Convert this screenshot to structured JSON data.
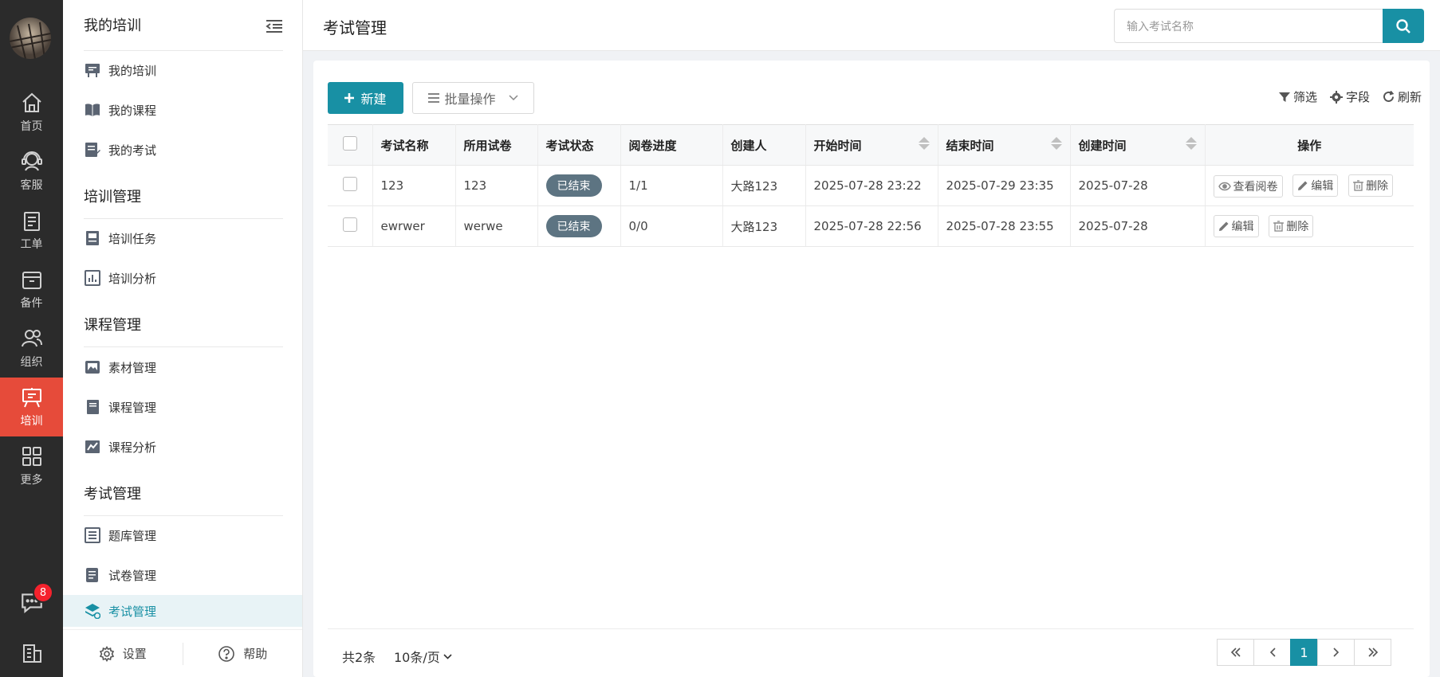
{
  "rail": {
    "items": [
      {
        "label": "首页",
        "icon": "home-icon"
      },
      {
        "label": "客服",
        "icon": "headset-icon"
      },
      {
        "label": "工单",
        "icon": "clipboard-icon"
      },
      {
        "label": "备件",
        "icon": "box-icon"
      },
      {
        "label": "组织",
        "icon": "people-icon"
      },
      {
        "label": "培训",
        "icon": "easel-icon",
        "active": true
      },
      {
        "label": "更多",
        "icon": "grid-icon"
      }
    ],
    "chat_badge": "8"
  },
  "sidebar": {
    "header": "我的培训",
    "sections": [
      {
        "title": "",
        "items": [
          "我的培训",
          "我的课程",
          "我的考试"
        ]
      },
      {
        "title": "培训管理",
        "items": [
          "培训任务",
          "培训分析"
        ]
      },
      {
        "title": "课程管理",
        "items": [
          "素材管理",
          "课程管理",
          "课程分析"
        ]
      },
      {
        "title": "考试管理",
        "items": [
          "题库管理",
          "试卷管理",
          "考试管理"
        ]
      }
    ],
    "settings_label": "设置",
    "help_label": "帮助"
  },
  "header": {
    "title": "考试管理",
    "search_placeholder": "输入考试名称"
  },
  "toolbar": {
    "new_label": "新建",
    "batch_label": "批量操作",
    "filter_label": "筛选",
    "fields_label": "字段",
    "refresh_label": "刷新"
  },
  "table": {
    "columns": [
      "考试名称",
      "所用试卷",
      "考试状态",
      "阅卷进度",
      "创建人",
      "开始时间",
      "结束时间",
      "创建时间",
      "操作"
    ],
    "rows": [
      {
        "name": "123",
        "paper": "123",
        "status": "已结束",
        "progress": "1/1",
        "creator": "大路123",
        "start": "2025-07-28 23:22",
        "end": "2025-07-29 23:35",
        "created": "2025-07-28",
        "actions": [
          "查看阅卷",
          "编辑",
          "删除"
        ]
      },
      {
        "name": "ewrwer",
        "paper": "werwe",
        "status": "已结束",
        "progress": "0/0",
        "creator": "大路123",
        "start": "2025-07-28 22:56",
        "end": "2025-07-28 23:55",
        "created": "2025-07-28",
        "actions": [
          "编辑",
          "删除"
        ]
      }
    ]
  },
  "pagination": {
    "total": "共2条",
    "page_size": "10条/页",
    "current_page": "1"
  },
  "colors": {
    "accent": "#1890a4",
    "rail_bg": "#2b2b2b",
    "rail_active": "#e64b3a",
    "status_badge": "#5d7482"
  }
}
